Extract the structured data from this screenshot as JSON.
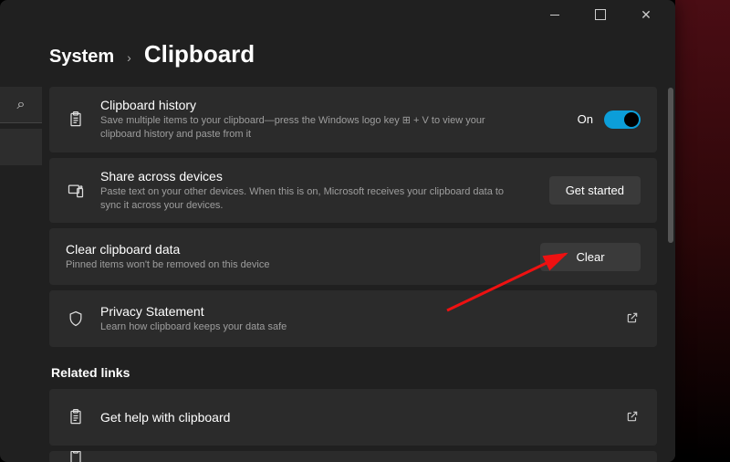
{
  "window": {
    "minimize": "–",
    "maximize": "▢",
    "close": "✕"
  },
  "breadcrumb": {
    "parent": "System",
    "chevron": "›",
    "page": "Clipboard"
  },
  "cards": {
    "history": {
      "title": "Clipboard history",
      "desc": "Save multiple items to your clipboard—press the Windows logo key ⊞ + V to view your clipboard history and paste from it",
      "state_label": "On"
    },
    "share": {
      "title": "Share across devices",
      "desc": "Paste text on your other devices. When this is on, Microsoft receives your clipboard data to sync it across your devices.",
      "button": "Get started"
    },
    "clear": {
      "title": "Clear clipboard data",
      "desc": "Pinned items won't be removed on this device",
      "button": "Clear"
    },
    "privacy": {
      "title": "Privacy Statement",
      "desc": "Learn how clipboard keeps your data safe"
    }
  },
  "related": {
    "heading": "Related links",
    "help": {
      "title": "Get help with clipboard"
    }
  },
  "icons": {
    "search": "⌕",
    "open": "↗"
  }
}
